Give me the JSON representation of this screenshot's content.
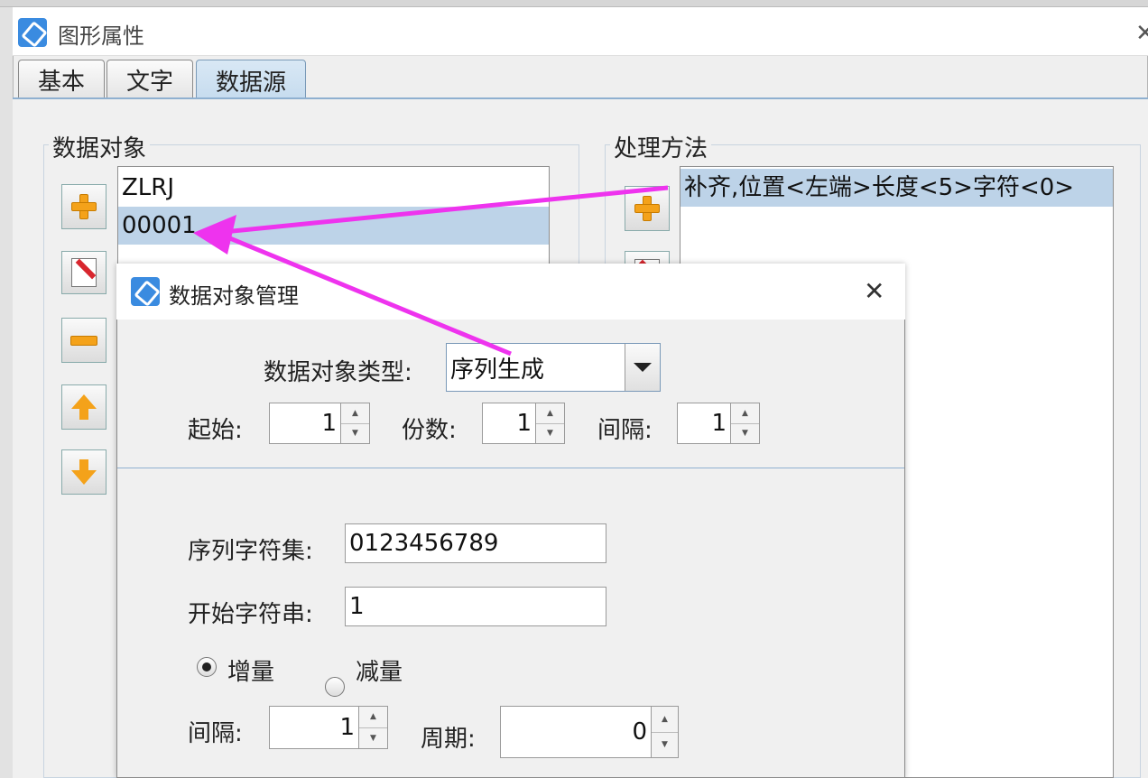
{
  "window": {
    "title": "图形属性"
  },
  "tabs": [
    {
      "label": "基本"
    },
    {
      "label": "文字"
    },
    {
      "label": "数据源",
      "active": true
    }
  ],
  "data_objects": {
    "legend": "数据对象",
    "items": [
      "ZLRJ",
      "00001"
    ],
    "selected_index": 1
  },
  "processing": {
    "legend": "处理方法",
    "items": [
      "补齐,位置<左端>长度<5>字符<0>"
    ]
  },
  "dialog": {
    "title": "数据对象管理",
    "type_label": "数据对象类型:",
    "type_value": "序列生成",
    "start_label": "起始:",
    "start_value": "1",
    "copies_label": "份数:",
    "copies_value": "1",
    "interval_label": "间隔:",
    "interval_value": "1",
    "charset_label": "序列字符集:",
    "charset_value": "0123456789",
    "start_string_label": "开始字符串:",
    "start_string_value": "1",
    "increment_label": "增量",
    "decrement_label": "减量",
    "increment_selected": true,
    "step_label": "间隔:",
    "step_value": "1",
    "period_label": "周期:",
    "period_value": "0"
  },
  "colors": {
    "annotation_arrow": "#ee33ee",
    "selection": "#bdd3e8"
  }
}
